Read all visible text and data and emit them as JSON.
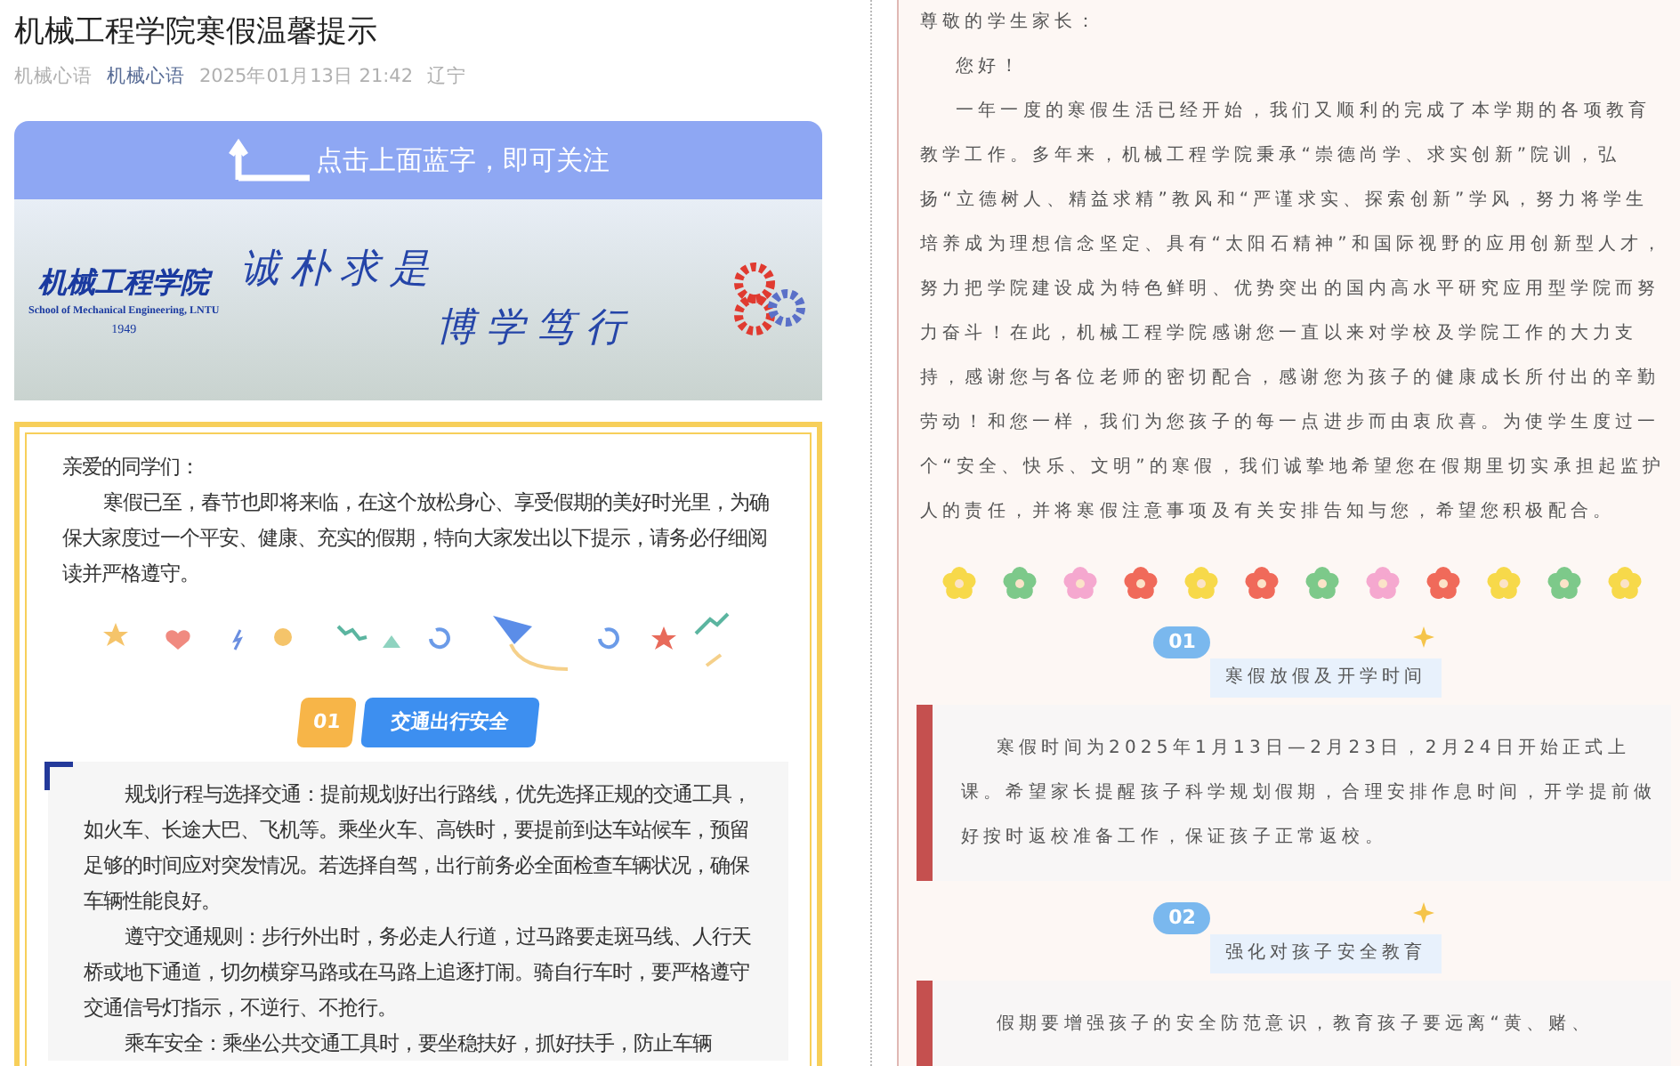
{
  "article": {
    "title": "机械工程学院寒假温馨提示",
    "meta": {
      "author": "机械心语",
      "account": "机械心语",
      "datetime": "2025年01月13日 21:42",
      "location": "辽宁"
    }
  },
  "banner": {
    "follow_hint": "点击上面蓝字，即可关注",
    "logo_name": "机械工程学院",
    "logo_subtitle": "School of Mechanical Engineering, LNTU",
    "logo_year": "1949",
    "motto_1": "诚朴求是",
    "motto_2": "博学笃行"
  },
  "student_letter": {
    "greeting": "亲爱的同学们：",
    "paragraphs": [
      "寒假已至，春节也即将来临，在这个放松身心、享受假期的美好时光里，为确保大家度过一个平安、健康、充实的假期，特向大家发出以下提示，请务必仔细阅读并严格遵守。"
    ],
    "sections": [
      {
        "number": "01",
        "title": "交通出行安全",
        "paragraphs": [
          "规划行程与选择交通：提前规划好出行路线，优先选择正规的交通工具，如火车、长途大巴、飞机等。乘坐火车、高铁时，要提前到达车站候车，预留足够的时间应对突发情况。若选择自驾，出行前务必全面检查车辆状况，确保车辆性能良好。",
          "遵守交通规则：步行外出时，务必走人行道，过马路要走斑马线、人行天桥或地下通道，切勿横穿马路或在马路上追逐打闹。骑自行车时，要严格遵守交通信号灯指示，不逆行、不抢行。",
          "乘车安全：乘坐公共交通工具时，要坐稳扶好，抓好扶手，防止车辆"
        ]
      }
    ]
  },
  "parent_letter": {
    "greeting": "尊敬的学生家长：",
    "salutation": "您好！",
    "paragraphs": [
      "一年一度的寒假生活已经开始，我们又顺利的完成了本学期的各项教育教学工作。多年来，机械工程学院秉承“崇德尚学、求实创新”院训，弘扬“立德树人、精益求精”教风和“严谨求实、探索创新”学风，努力将学生培养成为理想信念坚定、具有“太阳石精神”和国际视野的应用创新型人才，努力把学院建设成为特色鲜明、优势突出的国内高水平研究应用型学院而努力奋斗！在此，机械工程学院感谢您一直以来对学校及学院工作的大力支持，感谢您与各位老师的密切配合，感谢您为孩子的健康成长所付出的辛勤劳动！和您一样，我们为您孩子的每一点进步而由衷欣喜。为使学生度过一个“安全、快乐、文明”的寒假，我们诚挚地希望您在假期里切实承担起监护人的责任，并将寒假注意事项及有关安排告知与您，希望您积极配合。"
    ],
    "sections": [
      {
        "number": "01",
        "title": "寒假放假及开学时间",
        "paragraphs": [
          "寒假时间为2025年1月13日—2月23日，2月24日开始正式上课。希望家长提醒孩子科学规划假期，合理安排作息时间，开学提前做好按时返校准备工作，保证孩子正常返校。"
        ]
      },
      {
        "number": "02",
        "title": "强化对孩子安全教育",
        "paragraphs": [
          "假期要增强孩子的安全防范意识，教育孩子要远离“黄、赌、"
        ]
      }
    ]
  }
}
